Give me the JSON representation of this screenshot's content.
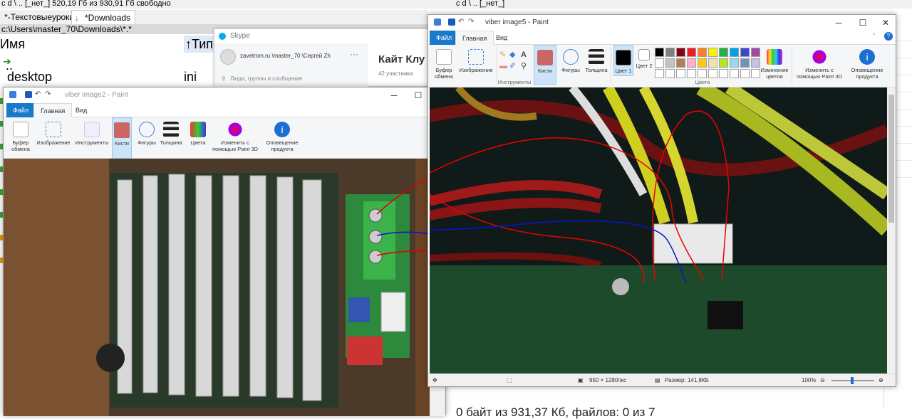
{
  "file_manager": {
    "top_left": "c  d  \\  ..  [_нет_]   520,19 Гб из 930,91 Гб свободно",
    "top_right": "c  d  \\  ..  [_нет_]",
    "tab1": "*-Текстовыеуроки-",
    "tab2": "*Downloads",
    "path": "c:\\Users\\master_70\\Downloads\\*.*",
    "col_name": "Имя",
    "col_type": "Тип",
    "row_up": "..",
    "row1_name": "desktop",
    "row1_type": "ini",
    "status": "0 байт из 931,37 Кб, файлов: 0 из 7"
  },
  "skype": {
    "title": "Skype",
    "user": "zavetrom.ru \\master_70 \\Сергей Zh",
    "search_placeholder": "Люди, группы и сообщения",
    "chat_title": "Кайт Клу",
    "members": "42 участника"
  },
  "paint_left": {
    "title": "viber image2 - Paint",
    "tabs": [
      "Файл",
      "Главная",
      "Вид"
    ],
    "groups": [
      "Буфер обмена",
      "Изображение",
      "Инструменты",
      "Кисти",
      "Фигуры",
      "Толщина",
      "Цвета",
      "Изменить с помощью Paint 3D",
      "Оповещение продукта"
    ]
  },
  "paint_right": {
    "title": "viber image5 - Paint",
    "tabs": [
      "Файл",
      "Главная",
      "Вид"
    ],
    "groups": [
      "Буфер обмена",
      "Изображение",
      "Кисти",
      "Фигуры",
      "Толщина",
      "Цвет 1",
      "Цвет 2",
      "Изменение цветов",
      "Изменить с помощью Paint 3D",
      "Оповещение продукта"
    ],
    "section_tools": "Инструменты",
    "section_colors": "Цвета",
    "status_size": "950 × 1280пкс",
    "status_filesize": "Размер: 141,8КБ",
    "zoom": "100%",
    "palette": [
      "#000000",
      "#7f7f7f",
      "#880015",
      "#ed1c24",
      "#ff7f27",
      "#fff200",
      "#22b14c",
      "#00a2e8",
      "#3f48cc",
      "#a349a4",
      "#ffffff",
      "#c3c3c3",
      "#b97a57",
      "#ffaec9",
      "#ffc90e",
      "#efe4b0",
      "#b5e61d",
      "#99d9ea",
      "#7092be",
      "#c8bfe7"
    ]
  }
}
